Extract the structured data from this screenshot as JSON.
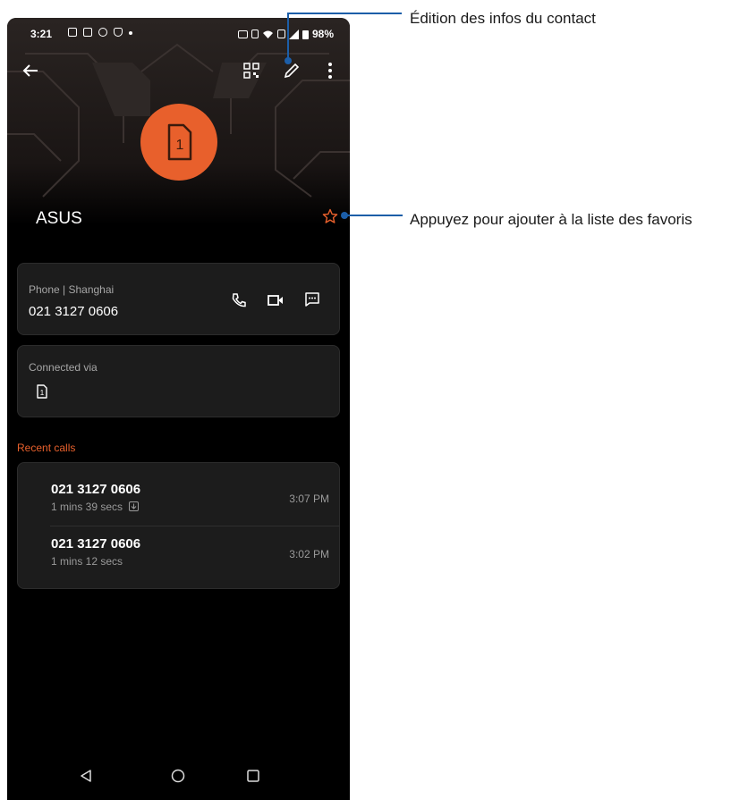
{
  "status_bar": {
    "time": "3:21",
    "battery": "98%"
  },
  "contact": {
    "name": "ASUS",
    "avatar_badge": "1"
  },
  "phone_card": {
    "label": "Phone | Shanghai",
    "number": "021 3127 0606"
  },
  "connected_card": {
    "label": "Connected via",
    "sim_badge": "1"
  },
  "recent_calls": {
    "title": "Recent calls",
    "items": [
      {
        "number": "021 3127 0606",
        "duration": "1 mins 39 secs",
        "time": "3:07 PM"
      },
      {
        "number": "021 3127 0606",
        "duration": "1 mins 12 secs",
        "time": "3:02 PM"
      }
    ]
  },
  "callouts": {
    "edit": "Édition des infos du contact",
    "favorite": "Appuyez pour ajouter à la liste des favoris"
  },
  "colors": {
    "accent": "#e8602c",
    "callout_line": "#1c5ea8",
    "card": "#1c1c1c"
  }
}
